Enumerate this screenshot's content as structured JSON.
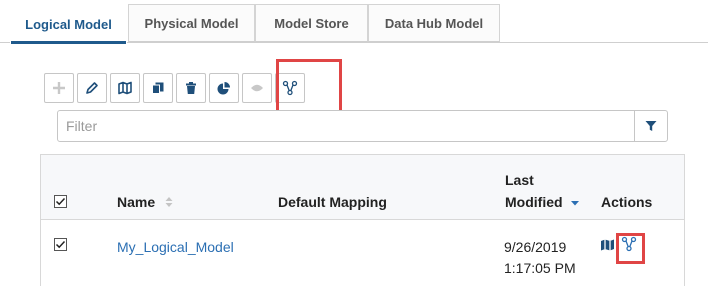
{
  "tabs": [
    {
      "label": "Logical Model",
      "active": true
    },
    {
      "label": "Physical Model",
      "active": false
    },
    {
      "label": "Model Store",
      "active": false
    },
    {
      "label": "Data Hub Model",
      "active": false
    }
  ],
  "toolbar": {
    "buttons": [
      {
        "icon": "plus-icon",
        "enabled": false
      },
      {
        "icon": "pencil-icon",
        "enabled": true
      },
      {
        "icon": "map-icon",
        "enabled": true
      },
      {
        "icon": "copy-icon",
        "enabled": true
      },
      {
        "icon": "trash-icon",
        "enabled": true
      },
      {
        "icon": "pie-chart-icon",
        "enabled": true
      },
      {
        "icon": "eye-icon",
        "enabled": false
      },
      {
        "icon": "model-graph-icon",
        "enabled": true
      }
    ]
  },
  "filter": {
    "placeholder": "Filter"
  },
  "table": {
    "headers": {
      "name": "Name",
      "default_mapping": "Default Mapping",
      "last_modified_line1": "Last",
      "last_modified_line2": "Modified",
      "actions": "Actions"
    },
    "rows": [
      {
        "checked": true,
        "name": "My_Logical_Model",
        "default_mapping": "",
        "date": "9/26/2019",
        "time": "1:17:05 PM"
      }
    ]
  },
  "colors": {
    "accent": "#1f5a8c",
    "link": "#2b6fb3",
    "highlight": "#e04545"
  }
}
